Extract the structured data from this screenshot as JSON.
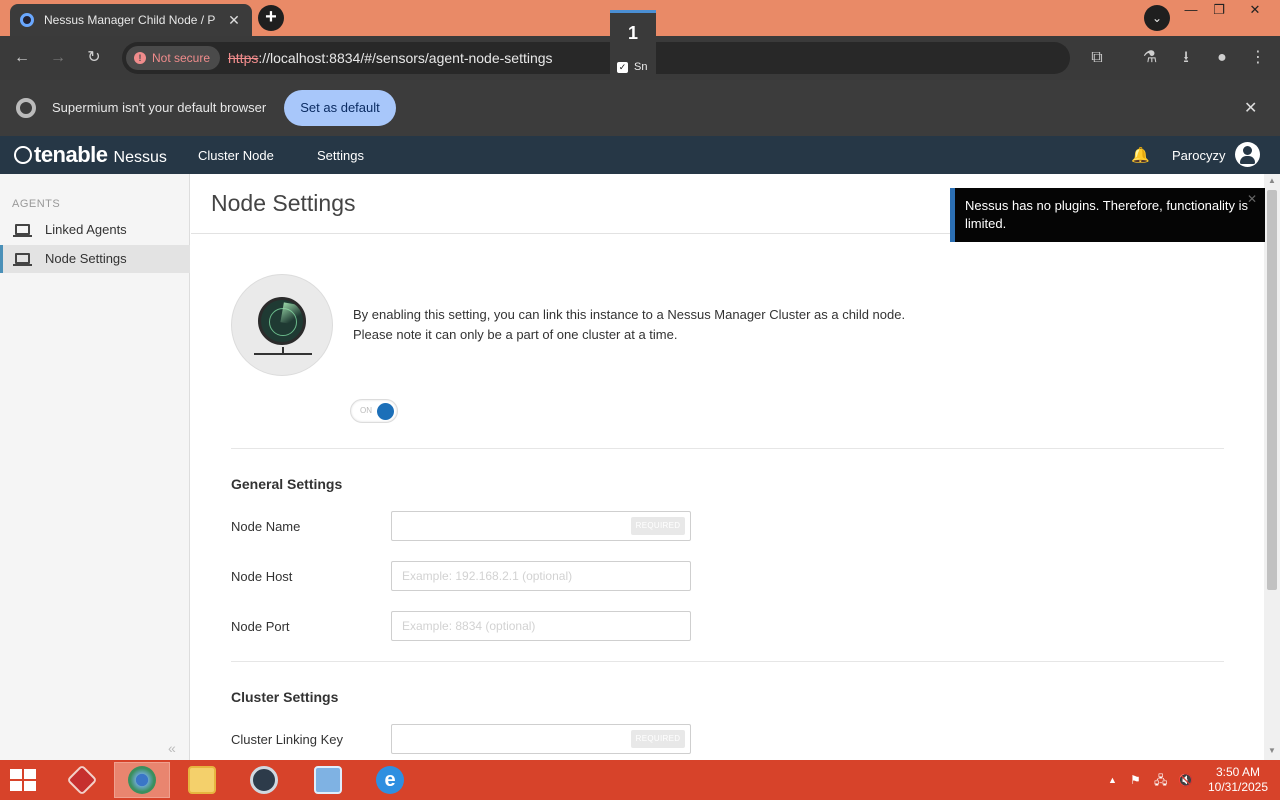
{
  "browser": {
    "tab_title": "Nessus Manager Child Node / P",
    "new_tab": "+",
    "tab_close": "✕",
    "tab_search": "⌄",
    "window": {
      "minimize": "—",
      "restore": "❐",
      "close": "✕"
    },
    "nav": {
      "back": "←",
      "forward": "→",
      "reload": "↻"
    },
    "security_label": "Not secure",
    "url_scheme": "https",
    "url_rest": "://localhost:8834/#/sensors/agent-node-settings",
    "overlay_number": "1",
    "overlay_check_label": "Sn",
    "toolbar_icons": {
      "bookmark": "☆",
      "extensions": "⧉",
      "labs": "⚗",
      "download": "⭳",
      "profile": "●",
      "menu": "⋮"
    },
    "infobar": {
      "message": "Supermium isn't your default browser",
      "button": "Set as default",
      "close": "✕"
    }
  },
  "app": {
    "brand": "tenable",
    "product": "Nessus",
    "nav": {
      "cluster_node": "Cluster Node",
      "settings": "Settings"
    },
    "user": "Parocyzy",
    "bell": "🔔"
  },
  "sidebar": {
    "heading": "AGENTS",
    "items": [
      {
        "label": "Linked Agents",
        "active": false
      },
      {
        "label": "Node Settings",
        "active": true
      }
    ],
    "collapse": "«"
  },
  "page": {
    "title": "Node Settings",
    "description_line1": "By enabling this setting, you can link this instance to a Nessus Manager Cluster as a child node.",
    "description_line2": "Please note it can only be a part of one cluster at a time.",
    "toggle_label": "ON",
    "toggle_on": true,
    "general_heading": "General Settings",
    "fields": {
      "node_name": {
        "label": "Node Name",
        "value": "",
        "placeholder": "",
        "badge": "REQUIRED"
      },
      "node_host": {
        "label": "Node Host",
        "value": "",
        "placeholder": "Example: 192.168.2.1 (optional)"
      },
      "node_port": {
        "label": "Node Port",
        "value": "",
        "placeholder": "Example: 8834 (optional)"
      }
    },
    "cluster_heading": "Cluster Settings",
    "cluster_key": {
      "label": "Cluster Linking Key",
      "value": "",
      "badge": "REQUIRED"
    }
  },
  "toast": {
    "message": "Nessus has no plugins. Therefore, functionality is limited.",
    "close": "✕"
  },
  "taskbar": {
    "apps": [
      "Acrobat",
      "Chrome",
      "File Explorer",
      "Nessus",
      "Control Panel",
      "Internet Explorer"
    ],
    "tray": {
      "expand": "▲",
      "flag": "⚑",
      "network": "🖧",
      "volume": "🔇"
    },
    "time": "3:50 AM",
    "date": "10/31/2025"
  },
  "colors": {
    "tabstrip": "#e98a67",
    "app_nav": "#263746",
    "toggle_on": "#1c6fb8",
    "toast_accent": "#2c6fb3",
    "taskbar": "#d7432a"
  }
}
